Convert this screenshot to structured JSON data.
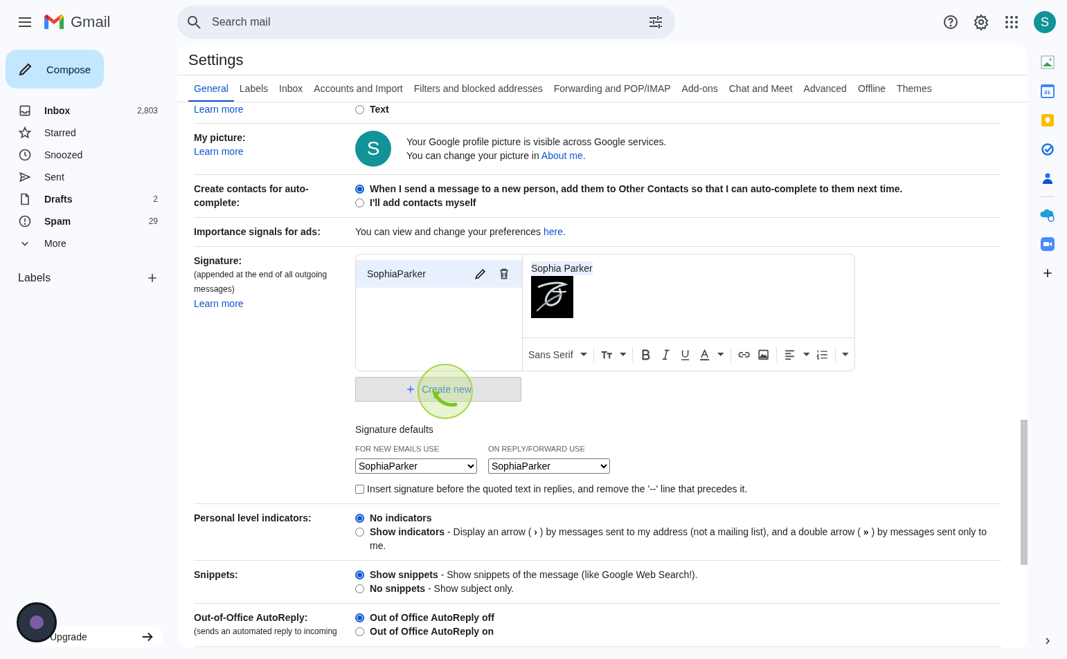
{
  "header": {
    "product": "Gmail",
    "search_placeholder": "Search mail",
    "account_initial": "S"
  },
  "compose": "Compose",
  "folders": [
    {
      "label": "Inbox",
      "count": "2,803",
      "bold": true
    },
    {
      "label": "Starred",
      "bold": false
    },
    {
      "label": "Snoozed",
      "bold": false
    },
    {
      "label": "Sent",
      "bold": false
    },
    {
      "label": "Drafts",
      "count": "2",
      "bold": true
    },
    {
      "label": "Spam",
      "count": "29",
      "bold": true
    },
    {
      "label": "More",
      "bold": false
    }
  ],
  "labels_heading": "Labels",
  "upgrade": "Upgrade",
  "settings": {
    "title": "Settings",
    "tabs": [
      {
        "label": "General",
        "selected": true
      },
      {
        "label": "Labels",
        "selected": false
      },
      {
        "label": "Inbox",
        "selected": false
      },
      {
        "label": "Accounts and Import",
        "selected": false
      },
      {
        "label": "Filters and blocked addresses",
        "selected": false
      },
      {
        "label": "Forwarding and POP/IMAP",
        "selected": false
      },
      {
        "label": "Add-ons",
        "selected": false
      },
      {
        "label": "Chat and Meet",
        "selected": false
      },
      {
        "label": "Advanced",
        "selected": false
      },
      {
        "label": "Offline",
        "selected": false
      },
      {
        "label": "Themes",
        "selected": false
      }
    ],
    "rows": [
      {
        "kind": "radio",
        "learn_more": "Learn more",
        "options": [
          {
            "title": "Text",
            "selected": false
          }
        ]
      },
      {
        "kind": "picture",
        "label": "My picture:",
        "learn_more": "Learn more",
        "avatar": "S",
        "line_1": "Your Google profile picture is visible across Google services.",
        "line_2": "You can change your picture in",
        "link": "About me",
        "tail": "."
      },
      {
        "kind": "radio",
        "label": "Create contacts for auto-complete:",
        "options": [
          {
            "title": "When I send a message to a new person, add them to Other Contacts so that I can auto-complete to them next time.",
            "selected": true
          },
          {
            "title": "I'll add contacts myself",
            "selected": false
          }
        ]
      },
      {
        "kind": "text",
        "label": "Importance signals for ads:",
        "text": "You can view and change your preferences",
        "link": "here",
        "tail": "."
      },
      {
        "kind": "signature",
        "label": "Signature:",
        "note": "(appended at the end of all outgoing messages)",
        "learn_more": "Learn more",
        "signatures": [
          {
            "name": "SophiaParker",
            "selected": true
          }
        ],
        "editor_text": "Sophia Parker",
        "font": "Sans Serif",
        "create_button": "Create new",
        "defaults_heading": "Signature defaults",
        "new_label": "FOR NEW EMAILS USE",
        "new_value": "SophiaParker",
        "reply_label": "ON REPLY/FORWARD USE",
        "reply_value": "SophiaParker",
        "insert_checkbox": {
          "label": "Insert signature before the quoted text in replies, and remove the '--' line that precedes it.",
          "checked": false
        }
      },
      {
        "kind": "radio",
        "label": "Personal level indicators:",
        "options": [
          {
            "title": "No indicators",
            "selected": true
          },
          {
            "title": "Show indicators",
            "detail": "- Display an arrow ( **›** ) by messages sent to my address (not a mailing list), and a double arrow ( **»** ) by messages sent only to me.",
            "selected": false
          }
        ]
      },
      {
        "kind": "radio",
        "label": "Snippets:",
        "options": [
          {
            "title": "Show snippets",
            "detail": "- Show snippets of the message (like Google Web Search!).",
            "selected": true
          },
          {
            "title": "No snippets",
            "detail": "- Show subject only.",
            "selected": false
          }
        ]
      },
      {
        "kind": "radio",
        "label": "Out-of-Office AutoReply:",
        "note": "(sends an automated reply to incoming",
        "options": [
          {
            "title": "Out of Office AutoReply off",
            "selected": true
          },
          {
            "title": "Out of Office AutoReply on",
            "selected": false
          }
        ]
      }
    ]
  },
  "rail": {
    "calendar_day": "31"
  }
}
